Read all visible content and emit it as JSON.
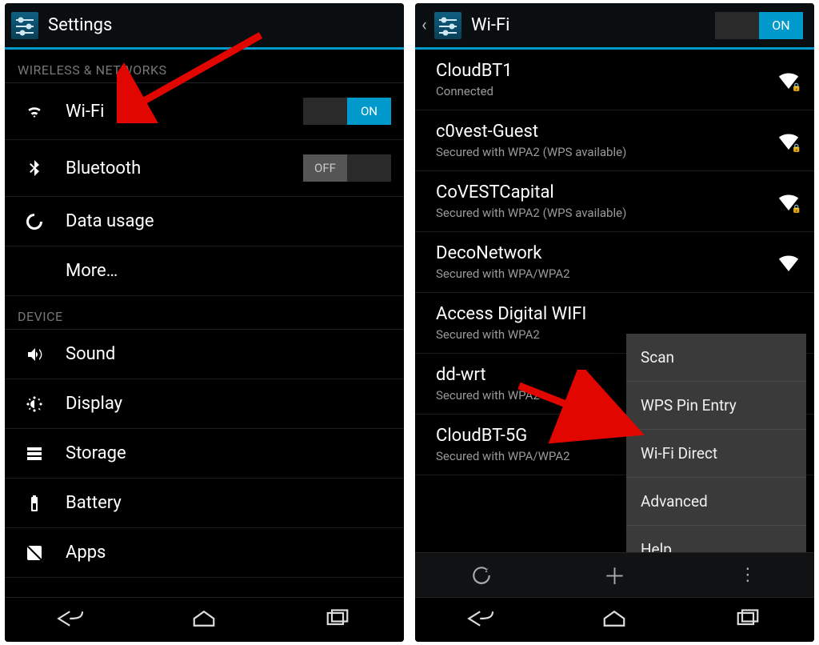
{
  "left": {
    "title": "Settings",
    "sections": {
      "wireless_header": "WIRELESS & NETWORKS",
      "device_header": "DEVICE"
    },
    "rows": {
      "wifi": "Wi-Fi",
      "bluetooth": "Bluetooth",
      "data_usage": "Data usage",
      "more": "More…",
      "sound": "Sound",
      "display": "Display",
      "storage": "Storage",
      "battery": "Battery",
      "apps": "Apps"
    },
    "toggle_on": "ON",
    "toggle_off": "OFF"
  },
  "right": {
    "title": "Wi-Fi",
    "toggle_on": "ON",
    "networks": [
      {
        "ssid": "CloudBT1",
        "sub": "Connected",
        "locked": true
      },
      {
        "ssid": "c0vest-Guest",
        "sub": "Secured with WPA2 (WPS available)",
        "locked": true
      },
      {
        "ssid": "CoVESTCapital",
        "sub": "Secured with WPA2 (WPS available)",
        "locked": true
      },
      {
        "ssid": "DecoNetwork",
        "sub": "Secured with WPA/WPA2",
        "locked": true
      },
      {
        "ssid": "Access Digital WIFI",
        "sub": "Secured with WPA2",
        "locked": true
      },
      {
        "ssid": "dd-wrt",
        "sub": "Secured with WPA2",
        "locked": true
      },
      {
        "ssid": "CloudBT-5G",
        "sub": "Secured with WPA/WPA2",
        "locked": true
      }
    ],
    "menu": {
      "scan": "Scan",
      "wps": "WPS Pin Entry",
      "direct": "Wi-Fi Direct",
      "advanced": "Advanced",
      "help": "Help"
    }
  }
}
